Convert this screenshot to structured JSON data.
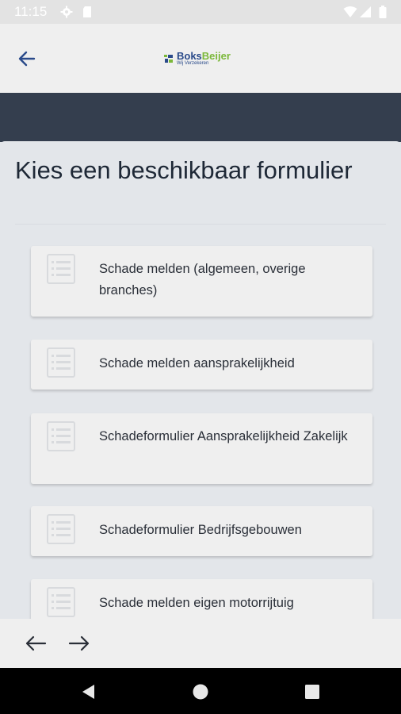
{
  "status_bar": {
    "time": "11:15",
    "icons": [
      "gear-icon",
      "sd-card-icon",
      "wifi-icon",
      "signal-icon",
      "battery-icon"
    ]
  },
  "app_bar": {
    "back_icon": "arrow-left-icon",
    "logo": {
      "name_part1": "Boks",
      "name_part2": "Beijer",
      "tagline": "Wij Verzekeren"
    }
  },
  "page": {
    "title": "Kies een beschikbaar formulier"
  },
  "forms": [
    {
      "label": "Schade melden (algemeen, overige branches)",
      "icon": "document-icon"
    },
    {
      "label": "Schade melden aansprakelijkheid",
      "icon": "document-icon"
    },
    {
      "label": "Schadeformulier Aansprakelijkheid Zakelijk",
      "icon": "document-icon"
    },
    {
      "label": "Schadeformulier Bedrijfsgebouwen",
      "icon": "document-icon"
    },
    {
      "label": "Schade melden eigen motorrijtuig",
      "icon": "document-icon"
    }
  ],
  "bottom_nav": {
    "back_icon": "arrow-left-icon",
    "forward_icon": "arrow-right-icon"
  },
  "system_nav": {
    "icons": [
      "back-triangle-icon",
      "home-circle-icon",
      "recents-square-icon"
    ]
  },
  "colors": {
    "banner": "#343e4e",
    "brand_blue": "#2a4a8a",
    "brand_green": "#7bb83a",
    "background": "#e3e6ea",
    "card": "#efefef"
  }
}
